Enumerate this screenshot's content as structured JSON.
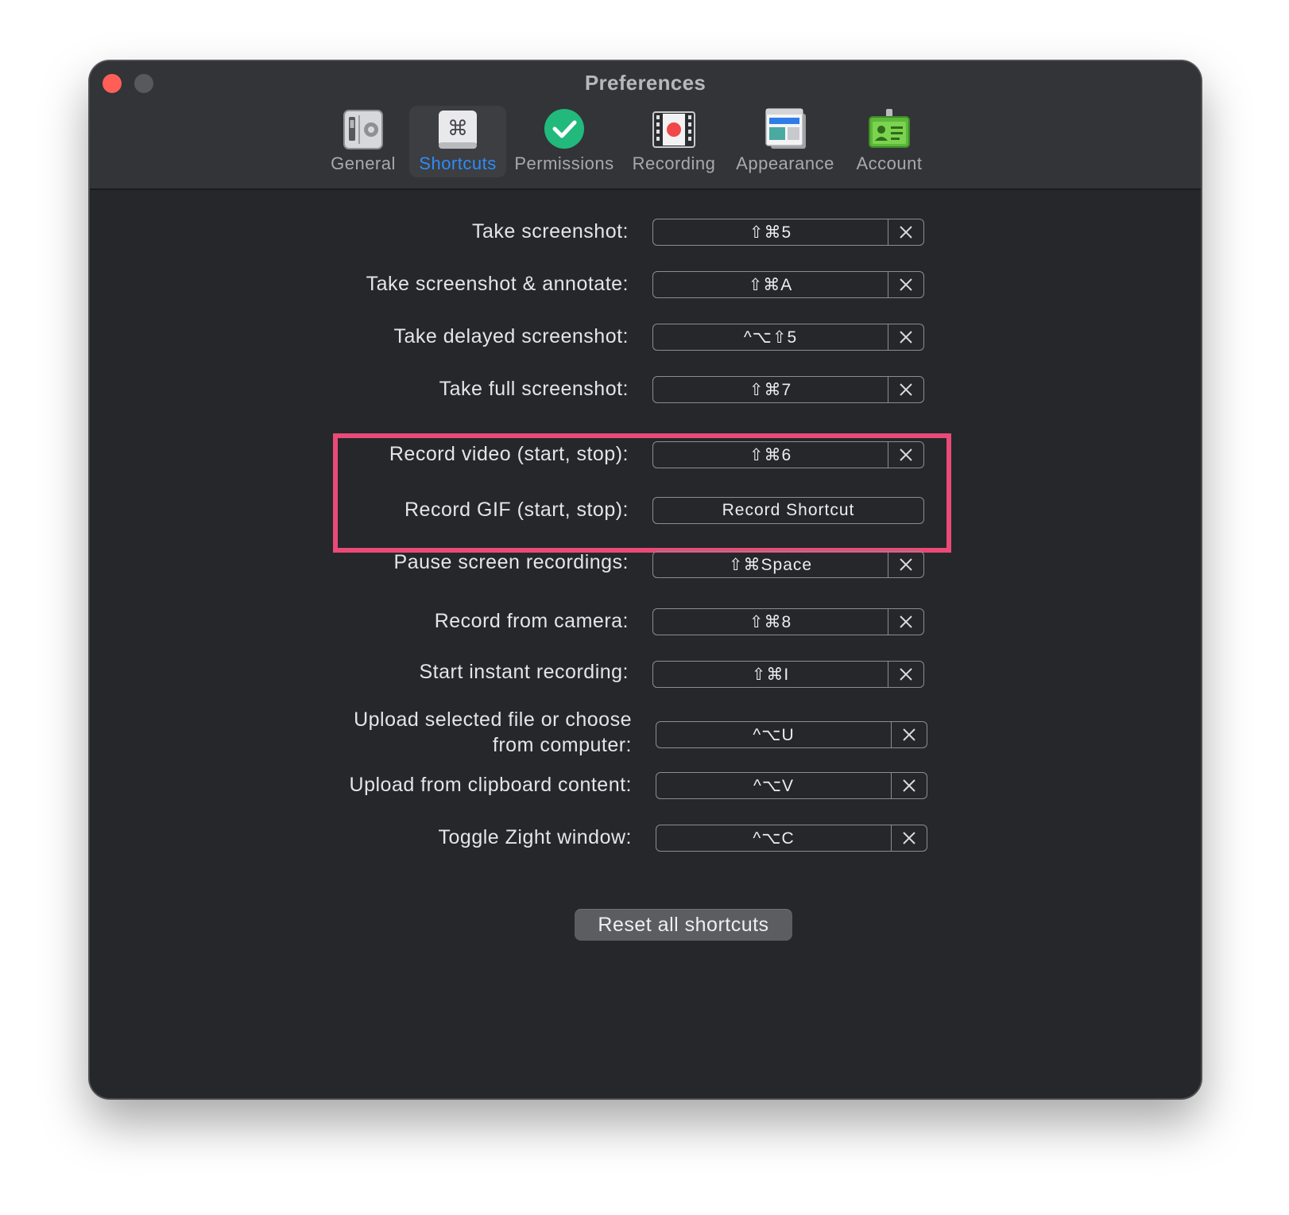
{
  "window": {
    "title": "Preferences"
  },
  "tabs": [
    {
      "label": "General",
      "icon": "general-settings-icon"
    },
    {
      "label": "Shortcuts",
      "icon": "command-key-icon",
      "active": true
    },
    {
      "label": "Permissions",
      "icon": "checkmark-icon"
    },
    {
      "label": "Recording",
      "icon": "film-record-icon"
    },
    {
      "label": "Appearance",
      "icon": "window-layout-icon"
    },
    {
      "label": "Account",
      "icon": "id-badge-icon"
    }
  ],
  "shortcuts": [
    {
      "label": "Take screenshot:",
      "value": "⇧⌘5"
    },
    {
      "label": "Take screenshot & annotate:",
      "value": "⇧⌘A"
    },
    {
      "label": "Take delayed screenshot:",
      "value": "^⌥⇧5"
    },
    {
      "label": "Take full screenshot:",
      "value": "⇧⌘7"
    },
    {
      "label": "Record video (start, stop):",
      "value": "⇧⌘6"
    },
    {
      "label": "Record GIF (start, stop):",
      "value": "Record Shortcut"
    },
    {
      "label": "Pause screen recordings:",
      "value": "⇧⌘Space"
    },
    {
      "label": "Record from camera:",
      "value": "⇧⌘8"
    },
    {
      "label": "Start instant recording:",
      "value": "⇧⌘I"
    },
    {
      "label_line1": "Upload selected file or choose",
      "label_line2": "from computer:",
      "value": "^⌥U"
    },
    {
      "label": "Upload from clipboard content:",
      "value": "^⌥V"
    },
    {
      "label": "Toggle Zight window:",
      "value": "^⌥C"
    }
  ],
  "reset_button": {
    "label": "Reset all shortcuts"
  },
  "colors": {
    "accent": "#2f8cf5",
    "highlight": "#ea4a78",
    "close": "#ff5f57",
    "window_bg": "#25272a"
  }
}
